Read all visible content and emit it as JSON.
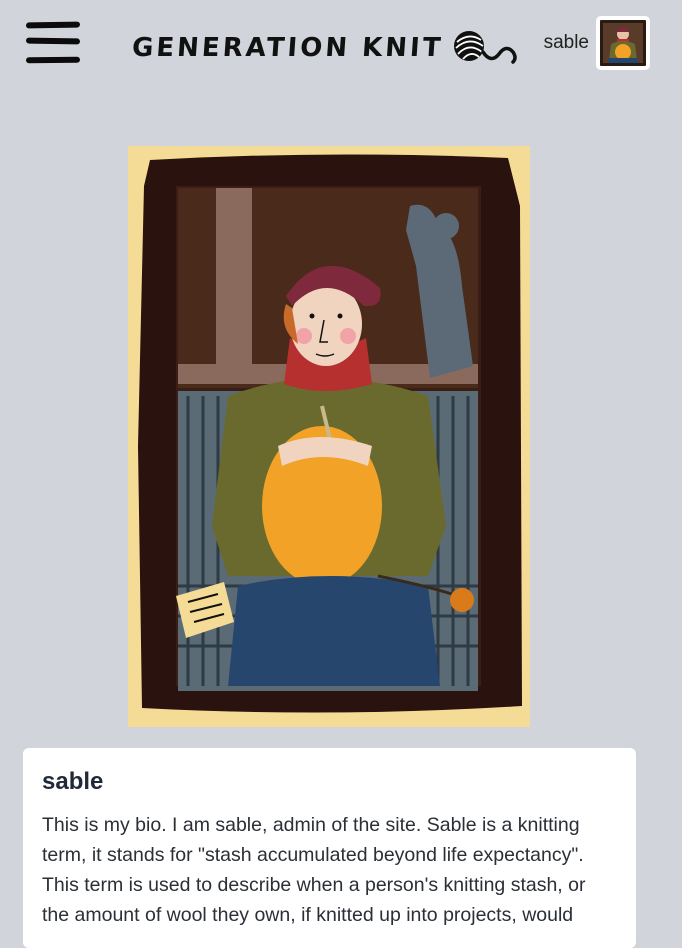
{
  "header": {
    "menu_icon": "hamburger-menu-icon",
    "logo_text": "GENERATION KNIT",
    "logo_icon": "yarn-ball-icon",
    "username": "sable",
    "avatar_icon": "user-avatar-thumbnail"
  },
  "profile": {
    "image_icon": "profile-illustration-knitter",
    "name": "sable",
    "bio": "This is my bio. I am sable, admin of the site. Sable is a knitting term, it stands for \"stash accumulated beyond life expectancy\". This term is used to describe when a person's knitting stash, or the amount of wool they own, if knitted up into projects, would"
  },
  "colors": {
    "page_bg": "#d1d5db",
    "card_bg": "#ffffff",
    "text": "#1f2937",
    "frame_bg": "#f5dc96",
    "sweater": "#6b6a2e",
    "knitting": "#f2a227",
    "scarf": "#b5302f",
    "hat": "#7e2a3c",
    "skirt": "#26466e"
  }
}
